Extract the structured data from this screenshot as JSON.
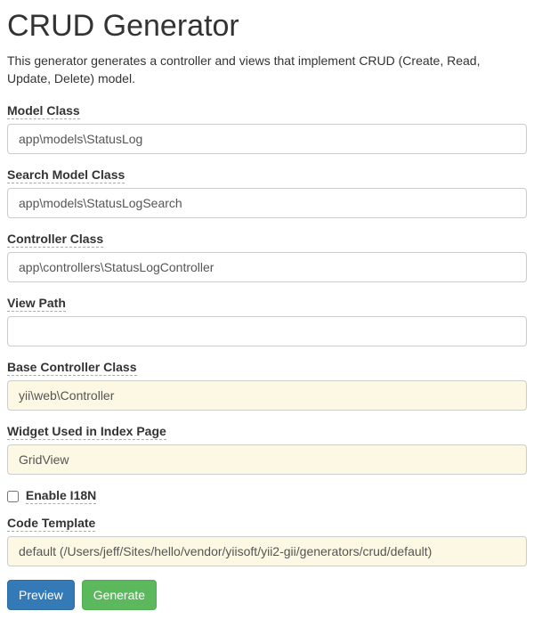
{
  "header": {
    "title": "CRUD Generator",
    "description": "This generator generates a controller and views that implement CRUD (Create, Read, Update, Delete) model."
  },
  "fields": {
    "modelClass": {
      "label": "Model Class",
      "value": "app\\models\\StatusLog"
    },
    "searchModelClass": {
      "label": "Search Model Class",
      "value": "app\\models\\StatusLogSearch"
    },
    "controllerClass": {
      "label": "Controller Class",
      "value": "app\\controllers\\StatusLogController"
    },
    "viewPath": {
      "label": "View Path",
      "value": ""
    },
    "baseControllerClass": {
      "label": "Base Controller Class",
      "value": "yii\\web\\Controller"
    },
    "widgetUsed": {
      "label": "Widget Used in Index Page",
      "value": "GridView"
    },
    "enableI18n": {
      "label": "Enable I18N",
      "checked": false
    },
    "codeTemplate": {
      "label": "Code Template",
      "value": "default (/Users/jeff/Sites/hello/vendor/yiisoft/yii2-gii/generators/crud/default)"
    }
  },
  "buttons": {
    "preview": "Preview",
    "generate": "Generate"
  }
}
